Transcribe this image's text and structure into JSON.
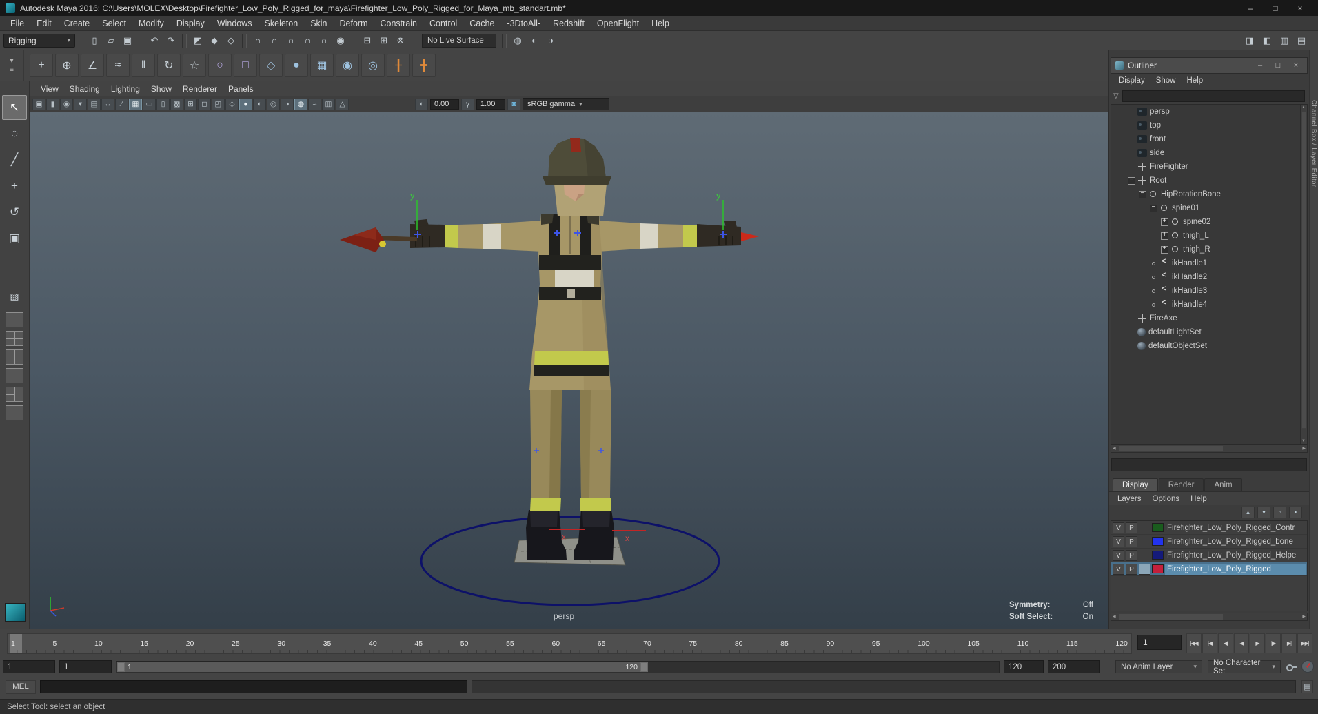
{
  "titlebar": {
    "title": "Autodesk Maya 2016: C:\\Users\\MOLEX\\Desktop\\Firefighter_Low_Poly_Rigged_for_maya\\Firefighter_Low_Poly_Rigged_for_Maya_mb_standart.mb*",
    "minimize": "–",
    "maximize": "□",
    "close": "×"
  },
  "menubar": [
    "File",
    "Edit",
    "Create",
    "Select",
    "Modify",
    "Display",
    "Windows",
    "Skeleton",
    "Skin",
    "Deform",
    "Constrain",
    "Control",
    "Cache",
    "-3DtoAll-",
    "Redshift",
    "OpenFlight",
    "Help"
  ],
  "statusline": {
    "mode": "Rigging",
    "arrow": "▾",
    "live_surface": "No Live Surface",
    "file_icons": [
      {
        "name": "new-scene-icon",
        "glyph": "▯"
      },
      {
        "name": "open-scene-icon",
        "glyph": "▱"
      },
      {
        "name": "save-scene-icon",
        "glyph": "▣"
      }
    ],
    "edit_icons": [
      {
        "name": "undo-icon",
        "glyph": "↶"
      },
      {
        "name": "redo-icon",
        "glyph": "↷"
      }
    ],
    "mask_icons": [
      {
        "name": "select-by-hierarchy-icon",
        "glyph": "◩"
      },
      {
        "name": "select-by-object-icon",
        "glyph": "◆"
      },
      {
        "name": "select-by-component-icon",
        "glyph": "◇"
      }
    ],
    "snap_icons": [
      {
        "name": "snap-to-grid-icon",
        "glyph": "∩"
      },
      {
        "name": "snap-to-curve-icon",
        "glyph": "∩"
      },
      {
        "name": "snap-to-point-icon",
        "glyph": "∩"
      },
      {
        "name": "snap-to-projected-center-icon",
        "glyph": "∩"
      },
      {
        "name": "snap-to-view-plane-icon",
        "glyph": "∩"
      },
      {
        "name": "make-live-icon",
        "glyph": "◉"
      }
    ],
    "history_icons": [
      {
        "name": "input-connections-icon",
        "glyph": "⊟"
      },
      {
        "name": "output-connections-icon",
        "glyph": "⊞"
      },
      {
        "name": "construction-history-icon",
        "glyph": "⊗"
      }
    ],
    "render_icons": [
      {
        "name": "render-current-frame-icon",
        "glyph": "◍"
      },
      {
        "name": "ipr-render-icon",
        "glyph": "◐"
      },
      {
        "name": "render-settings-icon",
        "glyph": "◑"
      }
    ],
    "panel_toggles": [
      {
        "name": "toggle-attribute-editor-icon",
        "glyph": "◨"
      },
      {
        "name": "toggle-tool-settings-icon",
        "glyph": "◧"
      },
      {
        "name": "toggle-channel-box-icon",
        "glyph": "▥"
      },
      {
        "name": "toggle-panel-layout-icon",
        "glyph": "▤"
      }
    ]
  },
  "shelf": {
    "selector_icons": [
      {
        "name": "shelf-tab-selector-icon",
        "glyph": "▾"
      },
      {
        "name": "shelf-menu-icon",
        "glyph": "≡"
      }
    ],
    "icons": [
      {
        "name": "joint-tool-icon",
        "glyph": "+",
        "color": "#c9d2d9"
      },
      {
        "name": "insert-joint-icon",
        "glyph": "⊕",
        "color": "#c9d2d9"
      },
      {
        "name": "ik-handle-icon",
        "glyph": "∠",
        "color": "#c9d2d9"
      },
      {
        "name": "ik-spline-icon",
        "glyph": "≈",
        "color": "#c9d2d9"
      },
      {
        "name": "mirror-joint-icon",
        "glyph": "‖",
        "color": "#c9d2d9"
      },
      {
        "name": "orient-joint-icon",
        "glyph": "↻",
        "color": "#c9d2d9"
      },
      {
        "name": "hik-character-icon",
        "glyph": "☆",
        "color": "#c9d2d9"
      },
      {
        "name": "nurbs-circle-icon",
        "glyph": "○",
        "color": "#b7a8e3"
      },
      {
        "name": "control-square-icon",
        "glyph": "□",
        "color": "#b7a8e3"
      },
      {
        "name": "locator-icon",
        "glyph": "◇",
        "color": "#9fc3e0"
      },
      {
        "name": "cluster-icon",
        "glyph": "●",
        "color": "#9fc3e0"
      },
      {
        "name": "lattice-icon",
        "glyph": "▦",
        "color": "#9fc3e0"
      },
      {
        "name": "soft-mod-icon",
        "glyph": "◉",
        "color": "#9fc3e0"
      },
      {
        "name": "wrap-deformer-icon",
        "glyph": "◎",
        "color": "#9fc3e0"
      },
      {
        "name": "measure-distance-icon",
        "glyph": "╂",
        "color": "#e08a3a"
      },
      {
        "name": "measure-angle-icon",
        "glyph": "╋",
        "color": "#e08a3a"
      }
    ]
  },
  "toolbox": {
    "tools": [
      {
        "name": "select-tool",
        "glyph": "↖",
        "selected": true
      },
      {
        "name": "lasso-select-tool",
        "glyph": "◌",
        "selected": false
      },
      {
        "name": "paint-select-tool",
        "glyph": "╱",
        "selected": false
      },
      {
        "name": "move-tool",
        "glyph": "+",
        "selected": false
      },
      {
        "name": "rotate-tool",
        "glyph": "↺",
        "selected": false
      },
      {
        "name": "scale-tool",
        "glyph": "▣",
        "selected": false
      }
    ],
    "last_tool": {
      "glyph": "▨"
    },
    "layouts": [
      {
        "name": "single-pane-layout-button",
        "kind": "single"
      },
      {
        "name": "four-pane-layout-button",
        "kind": "four"
      },
      {
        "name": "two-pane-side-layout-button",
        "kind": "twoside"
      },
      {
        "name": "two-pane-stacked-layout-button",
        "kind": "twostack"
      },
      {
        "name": "three-pane-layout-button",
        "kind": "three"
      },
      {
        "name": "outliner-persp-layout-button",
        "kind": "outpersp"
      }
    ]
  },
  "viewport": {
    "menus": [
      "View",
      "Shading",
      "Lighting",
      "Show",
      "Renderer",
      "Panels"
    ],
    "toolbar": {
      "icons": [
        {
          "name": "select-camera-icon",
          "glyph": "▣",
          "active": false
        },
        {
          "name": "lock-camera-icon",
          "glyph": "▮",
          "active": false
        },
        {
          "name": "camera-attributes-icon",
          "glyph": "◉",
          "active": false
        },
        {
          "name": "bookmarks-icon",
          "glyph": "▾",
          "active": false
        },
        {
          "name": "image-plane-icon",
          "glyph": "▤",
          "active": false
        },
        {
          "name": "2d-pan-zoom-icon",
          "glyph": "↔",
          "active": false
        },
        {
          "name": "grease-pencil-icon",
          "glyph": "∕",
          "active": false
        },
        {
          "name": "grid-icon",
          "glyph": "▦",
          "active": true
        },
        {
          "name": "film-gate-icon",
          "glyph": "▭",
          "active": false
        },
        {
          "name": "resolution-gate-icon",
          "glyph": "▯",
          "active": false
        },
        {
          "name": "gate-mask-icon",
          "glyph": "▩",
          "active": false
        },
        {
          "name": "field-chart-icon",
          "glyph": "⊞",
          "active": false
        },
        {
          "name": "safe-action-icon",
          "glyph": "◻",
          "active": false
        },
        {
          "name": "safe-title-icon",
          "glyph": "◰",
          "active": false
        },
        {
          "name": "wireframe-icon",
          "glyph": "◇",
          "active": false
        },
        {
          "name": "shaded-icon",
          "glyph": "●",
          "active": true
        },
        {
          "name": "textured-icon",
          "glyph": "◐",
          "active": false
        },
        {
          "name": "lights-icon",
          "glyph": "◎",
          "active": false
        },
        {
          "name": "shadows-icon",
          "glyph": "◑",
          "active": false
        },
        {
          "name": "ao-icon",
          "glyph": "◍",
          "active": true
        },
        {
          "name": "motion-blur-icon",
          "glyph": "≈",
          "active": false
        },
        {
          "name": "xray-icon",
          "glyph": "▥",
          "active": false
        },
        {
          "name": "isolate-select-icon",
          "glyph": "△",
          "active": false
        }
      ],
      "exposure_icon_glyph": "◐",
      "exposure_value": "0.00",
      "gamma_icon_glyph": "γ",
      "gamma_value": "1.00",
      "cm_icon_glyph": "◙",
      "color_space": "sRGB gamma",
      "arrow": "▾"
    },
    "camera_label": "persp",
    "hud": [
      {
        "label": "Symmetry:",
        "value": "Off"
      },
      {
        "label": "Soft Select:",
        "value": "On"
      }
    ],
    "markers": {
      "y_label": "y",
      "x_label": "x"
    }
  },
  "outliner": {
    "title": "Outliner",
    "min": "–",
    "max": "□",
    "close": "×",
    "menus": [
      "Display",
      "Show",
      "Help"
    ],
    "items": [
      {
        "label": "persp",
        "icon": "camera",
        "indent": 0,
        "expand": "none"
      },
      {
        "label": "top",
        "icon": "camera",
        "indent": 0,
        "expand": "none"
      },
      {
        "label": "front",
        "icon": "camera",
        "indent": 0,
        "expand": "none"
      },
      {
        "label": "side",
        "icon": "camera",
        "indent": 0,
        "expand": "none"
      },
      {
        "label": "FireFighter",
        "icon": "transform",
        "indent": 0,
        "expand": "none"
      },
      {
        "label": "Root",
        "icon": "transform",
        "indent": 0,
        "expand": "minus"
      },
      {
        "label": "HipRotationBone",
        "icon": "joint",
        "indent": 1,
        "expand": "minus"
      },
      {
        "label": "spine01",
        "icon": "joint",
        "indent": 2,
        "expand": "minus"
      },
      {
        "label": "spine02",
        "icon": "joint",
        "indent": 3,
        "expand": "plus"
      },
      {
        "label": "thigh_L",
        "icon": "joint",
        "indent": 3,
        "expand": "plus"
      },
      {
        "label": "thigh_R",
        "icon": "joint",
        "indent": 3,
        "expand": "plus"
      },
      {
        "label": "ikHandle1",
        "icon": "ik",
        "indent": 2,
        "expand": "circle"
      },
      {
        "label": "ikHandle2",
        "icon": "ik",
        "indent": 2,
        "expand": "circle"
      },
      {
        "label": "ikHandle3",
        "icon": "ik",
        "indent": 2,
        "expand": "circle"
      },
      {
        "label": "ikHandle4",
        "icon": "ik",
        "indent": 2,
        "expand": "circle"
      },
      {
        "label": "FireAxe",
        "icon": "transform",
        "indent": 0,
        "expand": "none"
      },
      {
        "label": "defaultLightSet",
        "icon": "set",
        "indent": 0,
        "expand": "none"
      },
      {
        "label": "defaultObjectSet",
        "icon": "set",
        "indent": 0,
        "expand": "none"
      }
    ]
  },
  "layer_editor": {
    "tabs": [
      {
        "label": "Display",
        "active": true
      },
      {
        "label": "Render",
        "active": false
      },
      {
        "label": "Anim",
        "active": false
      }
    ],
    "menus": [
      "Layers",
      "Options",
      "Help"
    ],
    "icons": [
      {
        "name": "layer-move-up-icon",
        "glyph": "▴"
      },
      {
        "name": "layer-move-down-icon",
        "glyph": "▾"
      },
      {
        "name": "create-empty-layer-icon",
        "glyph": "▫"
      },
      {
        "name": "create-layer-from-selected-icon",
        "glyph": "▪"
      }
    ],
    "layers": [
      {
        "v": "V",
        "p": "P",
        "color": "#1a5c1e",
        "name": "Firefighter_Low_Poly_Rigged_Contr",
        "selected": false
      },
      {
        "v": "V",
        "p": "P",
        "color": "#2233ee",
        "name": "Firefighter_Low_Poly_Rigged_bone",
        "selected": false
      },
      {
        "v": "V",
        "p": "P",
        "color": "#141a7a",
        "name": "Firefighter_Low_Poly_Rigged_Helpe",
        "selected": false
      },
      {
        "v": "V",
        "p": "P",
        "color": "#c3203c",
        "name": "Firefighter_Low_Poly_Rigged",
        "selected": true
      }
    ]
  },
  "side_tabs": [
    {
      "name": "channel-box-layer-editor-tab",
      "label": "Channel Box / Layer Editor"
    }
  ],
  "timeline": {
    "ticks": [
      "1",
      "5",
      "10",
      "15",
      "20",
      "25",
      "30",
      "35",
      "40",
      "45",
      "50",
      "55",
      "60",
      "65",
      "70",
      "75",
      "80",
      "85",
      "90",
      "95",
      "100",
      "105",
      "110",
      "115",
      "120"
    ],
    "current_frame": "1",
    "buttons": [
      {
        "name": "go-to-start-button",
        "glyph": "|◀◀"
      },
      {
        "name": "step-back-key-button",
        "glyph": "|◀"
      },
      {
        "name": "step-back-frame-button",
        "glyph": "◀|"
      },
      {
        "name": "play-backwards-button",
        "glyph": "◀"
      },
      {
        "name": "play-forwards-button",
        "glyph": "▶"
      },
      {
        "name": "step-forward-frame-button",
        "glyph": "|▶"
      },
      {
        "name": "step-forward-key-button",
        "glyph": "▶|"
      },
      {
        "name": "go-to-end-button",
        "glyph": "▶▶|"
      }
    ]
  },
  "range": {
    "playback_start": "1",
    "anim_start": "1",
    "range_start_label": "1",
    "range_end_label": "120",
    "playback_end": "120",
    "anim_end": "200",
    "anim_layer": "No Anim Layer",
    "character_set": "No Character Set",
    "arrow": "▾"
  },
  "command_line": {
    "label": "MEL",
    "input": "",
    "result": ""
  },
  "help_line": {
    "text": "Select Tool: select an object"
  }
}
